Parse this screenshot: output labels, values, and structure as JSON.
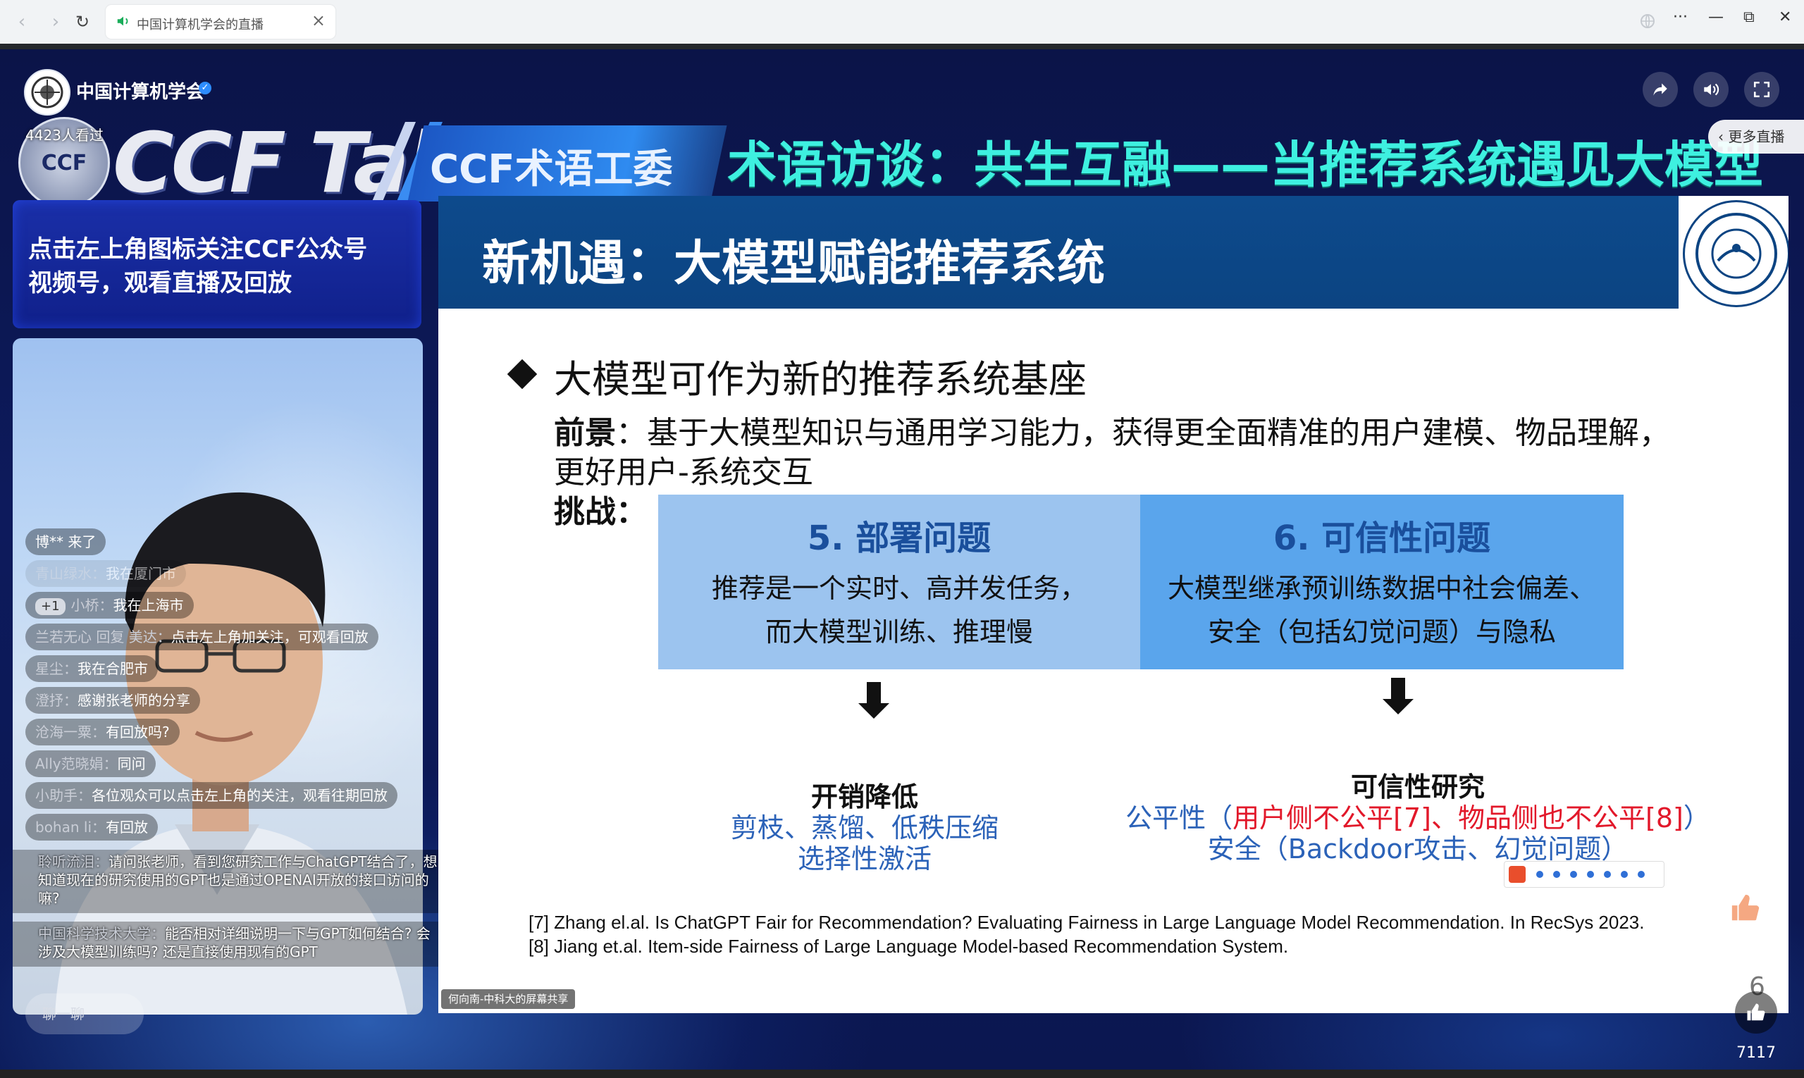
{
  "browser": {
    "tab_title": "中国计算机学会的直播",
    "close": "×",
    "menu": "···",
    "minimize": "—",
    "restore": "⧉",
    "close_window": "✕"
  },
  "header": {
    "host_name": "中国计算机学会",
    "viewers": "4423人看过",
    "brand": "CCF Talk",
    "committee": "CCF术语工委",
    "headline": "术语访谈：共生互融——当推荐系统遇见大模型",
    "more_live": "更多直播"
  },
  "follow_banner": {
    "line1": "点击左上角图标关注CCF公众号",
    "line2": "视频号，观看直播及回放"
  },
  "slide": {
    "title": "新机遇：大模型赋能推荐系统",
    "bullet": "大模型可作为新的推荐系统基座",
    "prospect_label": "前景",
    "prospect_text": "：基于大模型知识与通用学习能力，获得更全面精准的用户建模、物品理解，",
    "prospect_text2": "更好用户-系统交互",
    "challenge_label": "挑战：",
    "box5": {
      "title": "5. 部署问题",
      "line1": "推荐是一个实时、高并发任务，",
      "line2": "而大模型训练、推理慢"
    },
    "box6": {
      "title": "6. 可信性问题",
      "line1": "大模型继承预训练数据中社会偏差、",
      "line2": "安全（包括幻觉问题）与隐私"
    },
    "result5": {
      "head": "开销降低",
      "line1": "剪枝、蒸馏、低秩压缩",
      "line2": "选择性激活"
    },
    "result6": {
      "head": "可信性研究",
      "fair": "公平性（",
      "fair_red": "用户侧不公平[7]、物品侧也不公平[8]",
      "fair_end": "）",
      "safety": "安全（Backdoor攻击、幻觉问题）"
    },
    "ref7": "[7] Zhang el.al. Is ChatGPT Fair for Recommendation? Evaluating Fairness in Large Language Model Recommendation. In RecSys 2023.",
    "ref8": "[8] Jiang et.al. Item-side Fairness of Large Language Model-based Recommendation System.",
    "page": "6",
    "screen_share": "何向南-中科大的屏幕共享"
  },
  "chat": {
    "messages": [
      {
        "user": "",
        "text": "博** 来了"
      },
      {
        "user": "青山绿水：",
        "text": "我在厦门市"
      },
      {
        "badge": "+1",
        "user": "小桥：",
        "text": "我在上海市"
      },
      {
        "user": "兰若无心 回复 美达：",
        "text": "点击左上角加关注，可观看回放"
      },
      {
        "user": "星尘：",
        "text": "我在合肥市"
      },
      {
        "user": "澄抒：",
        "text": "感谢张老师的分享"
      },
      {
        "user": "沧海一粟：",
        "text": "有回放吗?"
      },
      {
        "user": "Ally范晓娟：",
        "text": "同问"
      },
      {
        "user": "小助手：",
        "text": "各位观众可以点击左上角的关注，观看往期回放"
      },
      {
        "user": "bohan li：",
        "text": "有回放"
      }
    ],
    "long1_user": "聆听流泪：",
    "long1_text": "请问张老师，看到您研究工作与ChatGPT结合了，想知道现在的研究使用的GPT也是通过OPENAI开放的接口访问的嘛?",
    "long2_user": "中国科学技术大学：",
    "long2_text": "能否相对详细说明一下与GPT如何结合? 会涉及大模型训练吗? 还是直接使用现有的GPT",
    "input_placeholder": "聊一聊"
  },
  "like_count": "7117",
  "colors": {
    "slide_bar": "#0c4482",
    "box5": "#9cc4ef",
    "box6": "#5aa5ec",
    "headline": "#3ef0e0",
    "accent_red": "#e2182a"
  }
}
